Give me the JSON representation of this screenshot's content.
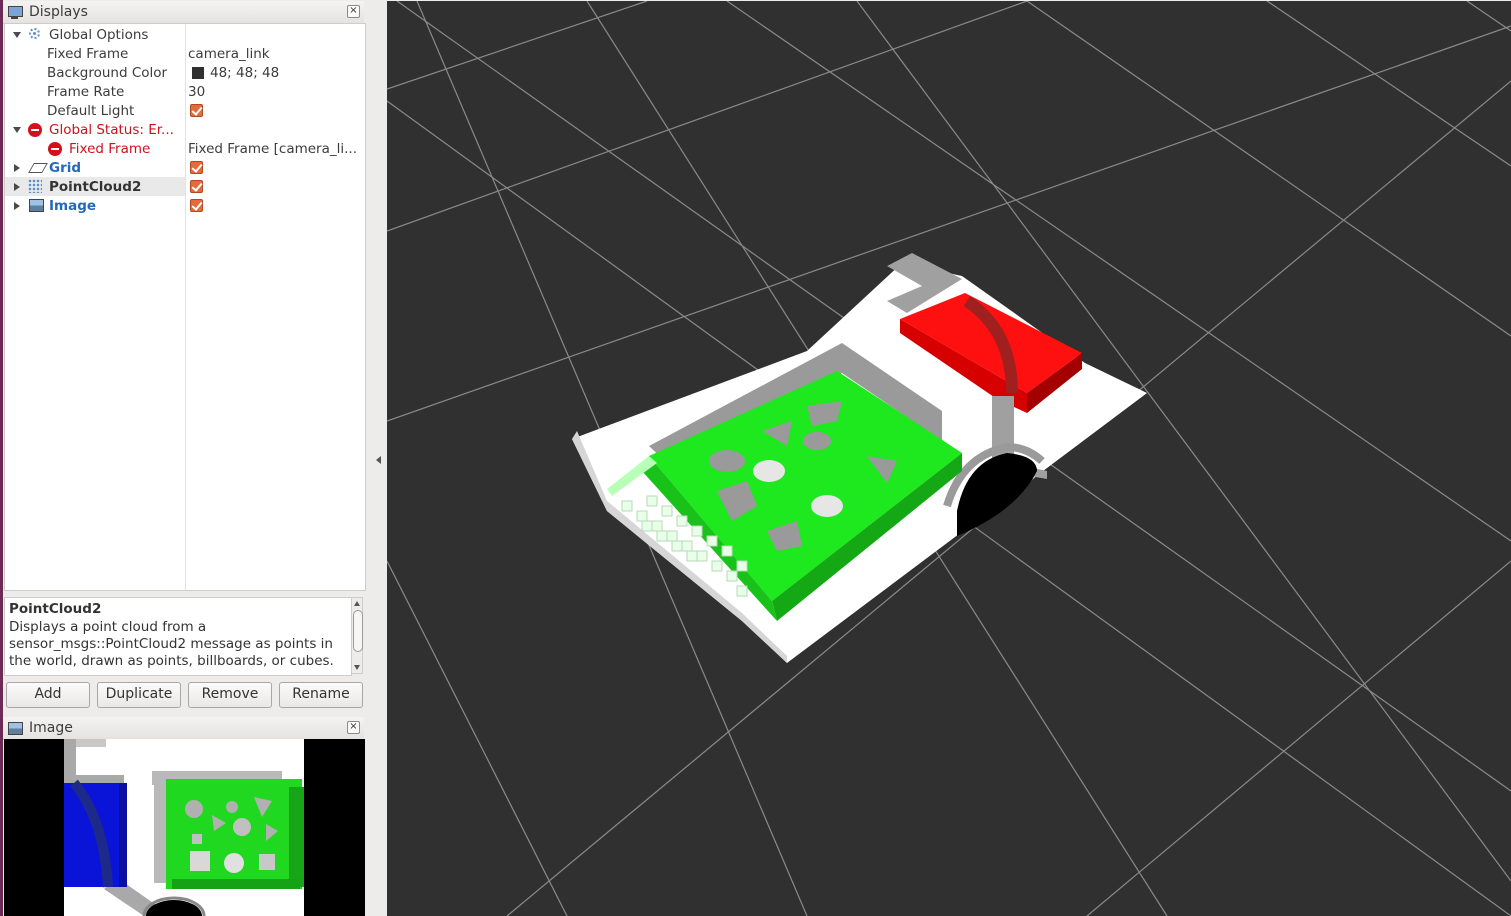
{
  "displays_panel": {
    "title": "Displays",
    "close_glyph": "×"
  },
  "tree": {
    "rows": [
      {
        "name": "Global Options",
        "value": "",
        "icon": "gear-icon"
      },
      {
        "name": "Fixed Frame",
        "value": "camera_link"
      },
      {
        "name": "Background Color",
        "value": "48; 48; 48",
        "color": "#303030"
      },
      {
        "name": "Frame Rate",
        "value": "30"
      },
      {
        "name": "Default Light",
        "checked": true
      },
      {
        "name": "Global Status: Er...",
        "status": "error",
        "icon": "error-icon"
      },
      {
        "name": "Fixed Frame",
        "value": "Fixed Frame [camera_li...",
        "status": "error",
        "icon": "error-icon"
      },
      {
        "name": "Grid",
        "checked": true,
        "icon": "grid-icon"
      },
      {
        "name": "PointCloud2",
        "checked": true,
        "icon": "pointcloud-icon",
        "selected": true
      },
      {
        "name": "Image",
        "checked": true,
        "icon": "image-icon"
      }
    ]
  },
  "description": {
    "title": "PointCloud2",
    "body": "Displays a point cloud from a sensor_msgs::PointCloud2 message as points in the world, drawn as points, billboards, or cubes."
  },
  "buttons": {
    "add": "Add",
    "duplicate": "Duplicate",
    "remove": "Remove",
    "rename": "Rename"
  },
  "image_panel": {
    "title": "Image",
    "close_glyph": "×"
  },
  "colors": {
    "render_background": "#303030",
    "error": "#c8141e",
    "accent": "#2568b6",
    "checkbox": "#e46b3d"
  }
}
